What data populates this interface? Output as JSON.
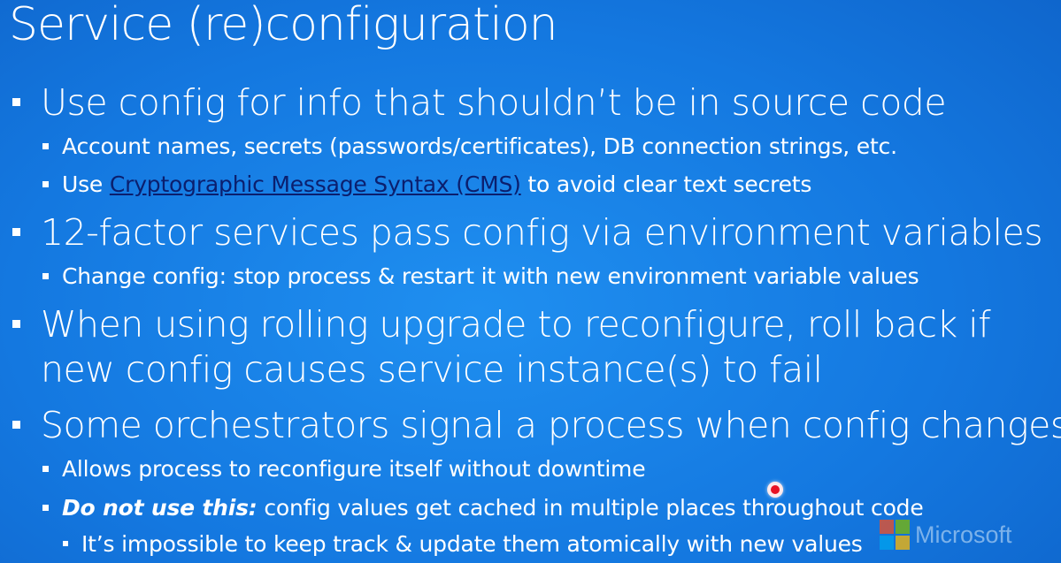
{
  "slide": {
    "title": "Service (re)configuration",
    "b1": {
      "text": "Use config for info that shouldn’t be in source code",
      "s1": "Account names, secrets (passwords/certificates), DB connection strings, etc.",
      "s2": {
        "pre": "Use ",
        "link": "Cryptographic Message Syntax (CMS)",
        "post": " to avoid clear text secrets"
      }
    },
    "b2": {
      "text": "12-factor services pass config via environment variables",
      "s1": "Change config: stop process & restart it with new environment variable values"
    },
    "b3": {
      "line1": "When using rolling upgrade to reconfigure, roll back if",
      "line2": "new config causes service instance(s) to fail"
    },
    "b4": {
      "text": "Some orchestrators signal a process when config changes",
      "s1": "Allows process to reconfigure itself without downtime",
      "s2": {
        "em": "Do not use this:",
        "rest": " config values get cached in multiple places throughout code"
      },
      "s2_sub": "It’s impossible to keep track & update them atomically with new values"
    }
  },
  "watermark": {
    "wordmark": "Microsoft",
    "logo_colors": [
      "#f25022",
      "#7fba00",
      "#00a4ef",
      "#ffb900"
    ]
  },
  "colors": {
    "background": "#1478e0",
    "text": "#ffffff",
    "link": "#0b1f6e",
    "cursor": "#e81123"
  }
}
